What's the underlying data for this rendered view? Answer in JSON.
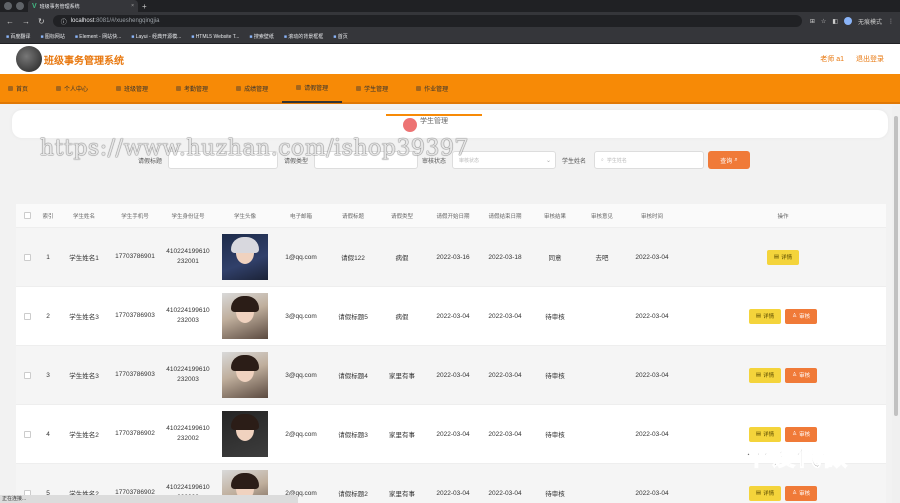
{
  "browser": {
    "tab_title": "班级事务管理系统",
    "address_host": "localhost",
    "address_rest": ":8081/#/xueshengqingjia",
    "profile_label": "无痕模式",
    "bookmarks": [
      "百度翻译",
      "图标网站",
      "Element - 网站快...",
      "Layui - 经典开源模...",
      "HTML5 Website T...",
      "搜索壁纸",
      "滚动的背景框框",
      "首页"
    ]
  },
  "app": {
    "title": "班级事务管理系统",
    "user_label": "老师 a1",
    "logout_label": "退出登录"
  },
  "nav": {
    "items": [
      {
        "label": "首页",
        "active": false
      },
      {
        "label": "个人中心",
        "active": false
      },
      {
        "label": "班级管理",
        "active": false
      },
      {
        "label": "考勤管理",
        "active": false
      },
      {
        "label": "成绩管理",
        "active": false
      },
      {
        "label": "请假管理",
        "active": true
      },
      {
        "label": "学生管理",
        "active": false
      },
      {
        "label": "作业管理",
        "active": false
      }
    ]
  },
  "breadcrumb": "学生管理",
  "search": {
    "field1_label": "请假标题",
    "field2_label": "请假类型",
    "field3_label": "审核状态",
    "field3_placeholder": "审核状态",
    "field4_label": "学生姓名",
    "field4_placeholder": "学生姓名",
    "button_label": "查询"
  },
  "watermark": "https://www.huzhan.com/ishop39397",
  "table": {
    "headers": [
      "索引",
      "学生姓名",
      "学生手机号",
      "学生身份证号",
      "学生头像",
      "电子邮箱",
      "请假标题",
      "请假类型",
      "请假开始日期",
      "请假结束日期",
      "审核结果",
      "审核意见",
      "审核时间",
      "操作"
    ],
    "detail_label": "详情",
    "audit_label": "审核",
    "rows": [
      {
        "index": "1",
        "name": "学生姓名1",
        "phone": "17703786901",
        "id_card": "410224199610232001",
        "email": "1@qq.com",
        "title": "请假122",
        "type": "病假",
        "start": "2022-03-16",
        "end": "2022-03-18",
        "status": "同意",
        "opinion": "去吧",
        "time": "2022-03-04",
        "can_audit": false
      },
      {
        "index": "2",
        "name": "学生姓名3",
        "phone": "17703786903",
        "id_card": "410224199610232003",
        "email": "3@qq.com",
        "title": "请假标题5",
        "type": "病假",
        "start": "2022-03-04",
        "end": "2022-03-04",
        "status": "待审核",
        "opinion": "",
        "time": "2022-03-04",
        "can_audit": true
      },
      {
        "index": "3",
        "name": "学生姓名3",
        "phone": "17703786903",
        "id_card": "410224199610232003",
        "email": "3@qq.com",
        "title": "请假标题4",
        "type": "家里有事",
        "start": "2022-03-04",
        "end": "2022-03-04",
        "status": "待审核",
        "opinion": "",
        "time": "2022-03-04",
        "can_audit": true
      },
      {
        "index": "4",
        "name": "学生姓名2",
        "phone": "17703786902",
        "id_card": "410224199610232002",
        "email": "2@qq.com",
        "title": "请假标题3",
        "type": "家里有事",
        "start": "2022-03-04",
        "end": "2022-03-04",
        "status": "待审核",
        "opinion": "",
        "time": "2022-03-04",
        "can_audit": true
      },
      {
        "index": "5",
        "name": "学生姓名2",
        "phone": "17703786902",
        "id_card": "410224199610232002",
        "email": "2@qq.com",
        "title": "请假标题2",
        "type": "家里有事",
        "start": "2022-03-04",
        "end": "2022-03-04",
        "status": "待审核",
        "opinion": "",
        "time": "2022-03-04",
        "can_audit": true
      }
    ]
  },
  "status_bar": "正在连接...",
  "corner_text": "毕设代做",
  "colors": {
    "accent": "#f78a06",
    "title": "#e8780f",
    "search_button": "#f07a38",
    "detail_button": "#f4d43b"
  }
}
